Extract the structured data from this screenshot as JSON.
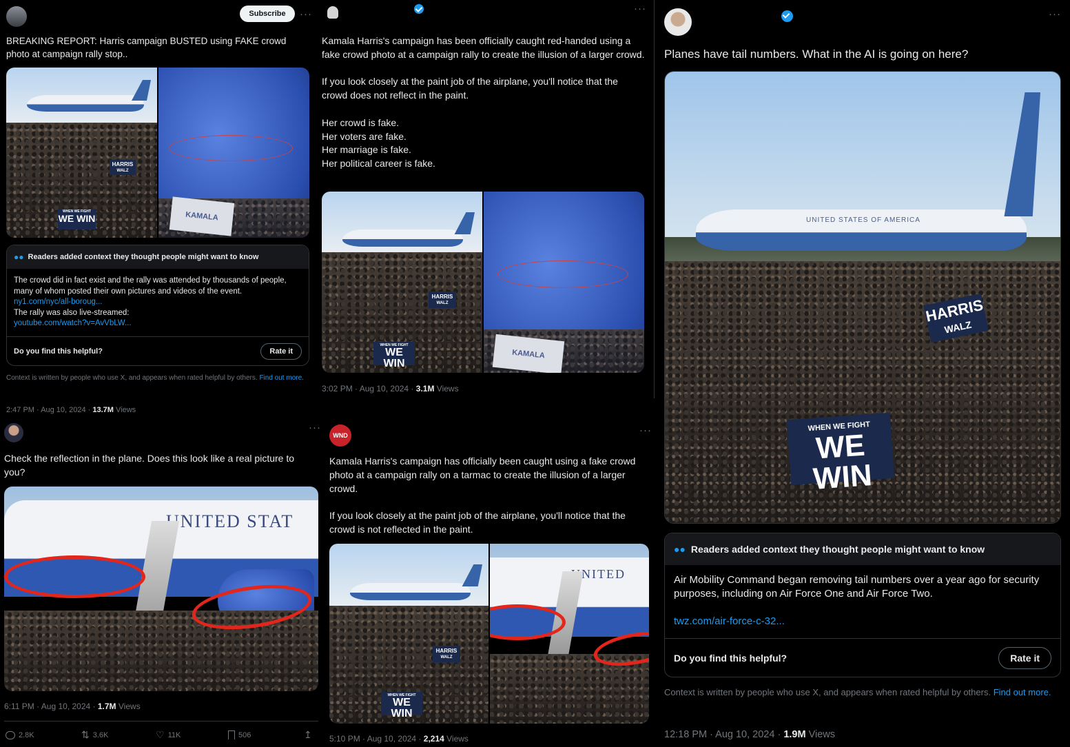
{
  "post1": {
    "subscribe_label": "Subscribe",
    "more": "···",
    "text": "BREAKING REPORT: Harris campaign BUSTED using FAKE crowd photo at campaign rally stop..",
    "note": {
      "header": "Readers added context they thought people might want to know",
      "body_line1": "The crowd did in fact exist and the rally was attended by thousands of people, many of whom posted their own pictures and videos of the event.",
      "link1": "ny1.com/nyc/all-boroug...",
      "body_line2": "The rally was also live-streamed:",
      "link2": "youtube.com/watch?v=AvVbLW...",
      "helpful_question": "Do you find this helpful?",
      "rate_label": "Rate it"
    },
    "disclaimer": "Context is written by people who use X, and appears when rated helpful by others.",
    "disclaimer_link": "Find out more.",
    "timestamp": "2:47 PM · Aug 10, 2024 · ",
    "views_count": "13.7M",
    "views_label": " Views"
  },
  "post2": {
    "more": "···",
    "text": "Kamala Harris's campaign has been officially caught red-handed using a fake crowd photo at a campaign rally to create the illusion of a larger crowd.\n\nIf you look closely at the paint job of the airplane, you'll notice that the crowd does not reflect in the paint.\n\nHer crowd is fake.\nHer voters are fake.\nHer marriage is fake.\nHer political career is fake.",
    "timestamp": "3:02 PM · Aug 10, 2024 · ",
    "views_count": "3.1M",
    "views_label": " Views"
  },
  "post3": {
    "more": "···",
    "text": "Planes have tail numbers. What in the AI is going on here?",
    "note": {
      "header": "Readers added context they thought people might want to know",
      "body": "Air Mobility Command began removing tail numbers over a year ago for security purposes, including on Air Force One and Air Force Two.",
      "link": "twz.com/air-force-c-32...",
      "helpful_question": "Do you find this helpful?",
      "rate_label": "Rate it"
    },
    "disclaimer": "Context is written by people who use X, and appears when rated helpful by others.",
    "disclaimer_link": "Find out more.",
    "timestamp": "12:18 PM · Aug 10, 2024 · ",
    "views_count": "1.9M",
    "views_label": " Views"
  },
  "post4": {
    "more": "···",
    "text": "Check the reflection in the plane. Does this look like a real picture to you?",
    "timestamp": "6:11 PM · Aug 10, 2024 · ",
    "views_count": "1.7M",
    "views_label": " Views",
    "replies": "2.8K",
    "reposts": "3.6K",
    "likes": "11K",
    "bookmarks": "506"
  },
  "post5": {
    "avatar_text": "WND",
    "more": "···",
    "text": "Kamala Harris's campaign has officially been caught using a fake crowd photo at a campaign rally on a tarmac to create the illusion of a larger crowd.\n\nIf you look closely at the paint job of the airplane, you'll notice that the crowd is not reflected in the paint.",
    "timestamp": "5:10 PM · Aug 10, 2024 · ",
    "views_count": "2,214",
    "views_label": " Views"
  },
  "photo_text": {
    "harris": "HARRIS",
    "walz": "WALZ",
    "when_we_fight": "WHEN WE FIGHT",
    "we_win": "WE WIN",
    "kamala": "KAMALA",
    "united_states": "UNITED STATES OF AMERICA",
    "united_stat": "UNITED STAT",
    "united": "UNITED"
  },
  "icons": {
    "verified": "verified-badge-icon",
    "community_notes": "people-icon",
    "reply": "reply-icon",
    "repost": "repost-icon",
    "like": "heart-icon",
    "bookmark": "bookmark-icon",
    "share": "share-icon"
  },
  "colors": {
    "background": "#000000",
    "text": "#e7e9ea",
    "muted": "#71767b",
    "link": "#1d9bf0",
    "border": "#2f3336"
  }
}
